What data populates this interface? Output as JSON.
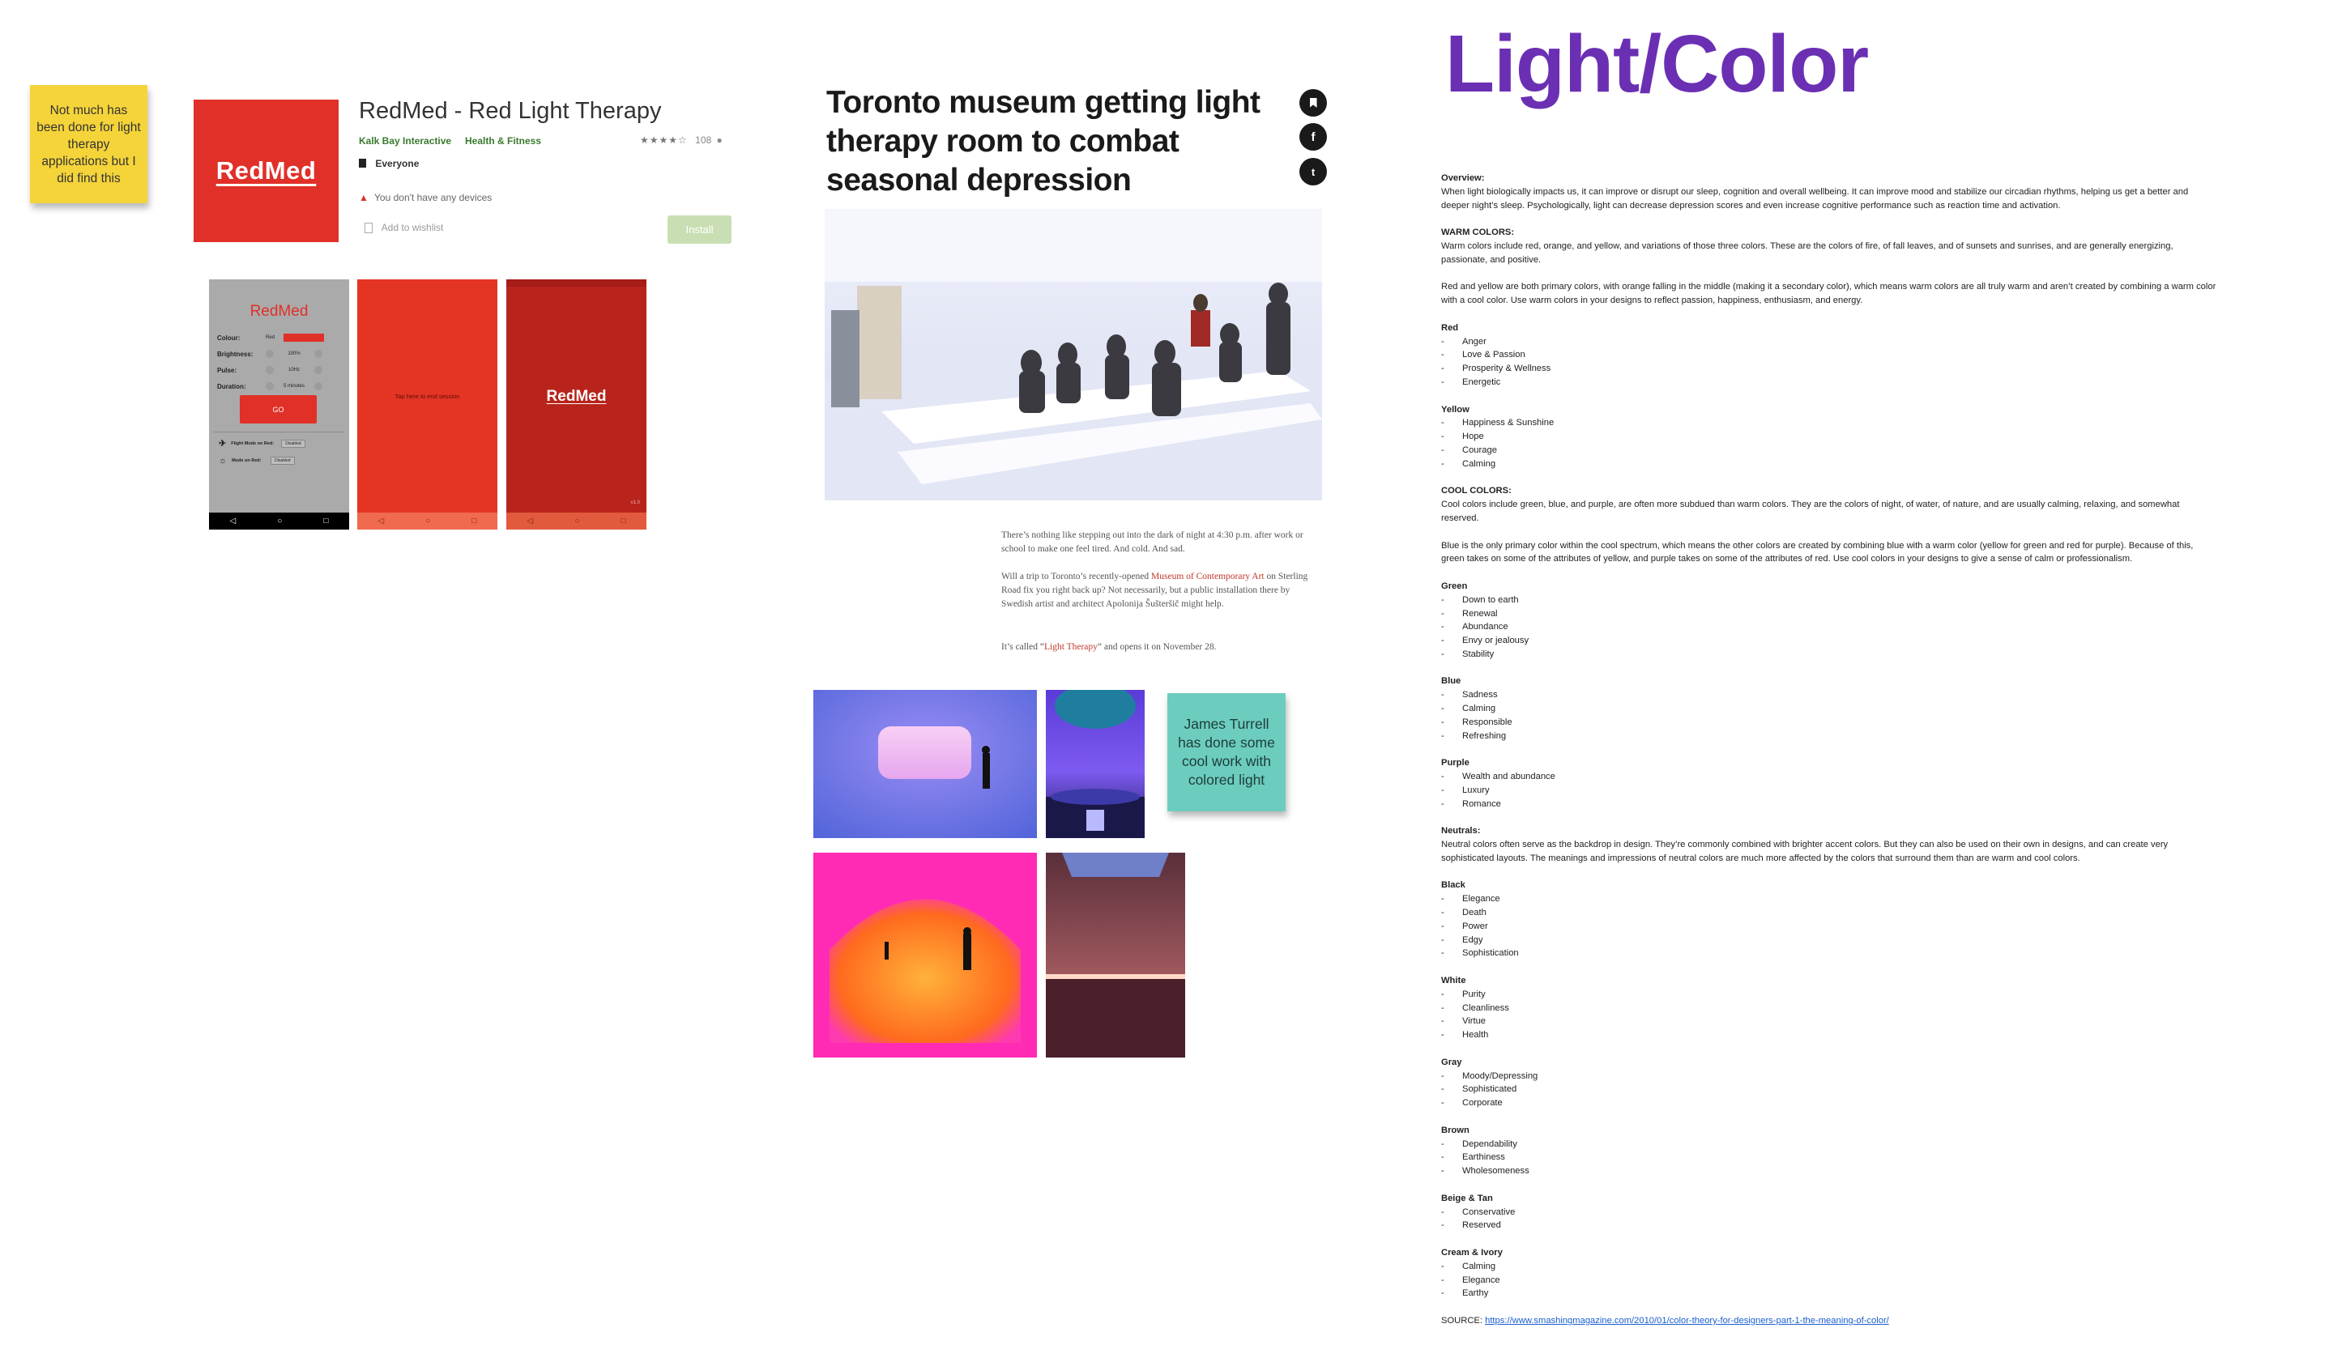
{
  "sticky_notes": {
    "yellow": "Not much has been done for light therapy applications but I did find this",
    "teal": "James Turrell has done some cool work with colored light"
  },
  "app_listing": {
    "logo_text": "RedMed",
    "title": "RedMed - Red Light Therapy",
    "developer": "Kalk Bay Interactive",
    "category": "Health & Fitness",
    "rating_count": "108",
    "content_rating": "Everyone",
    "devices_warning": "You don't have any devices",
    "wishlist": "Add to wishlist",
    "install": "Install",
    "screenshots": {
      "settings": {
        "title": "RedMed",
        "rows": [
          {
            "label": "Colour:",
            "value": "Red"
          },
          {
            "label": "Brightness:",
            "value": "100%"
          },
          {
            "label": "Pulse:",
            "value": "10Hz"
          },
          {
            "label": "Duration:",
            "value": "5 minutes"
          }
        ],
        "go": "GO",
        "flight_mode": "Flight Mode on Red:",
        "mode_on_red": "Mode on Red:",
        "toggle": "Disabled"
      },
      "session": {
        "text": "Tap here to end session"
      },
      "splash": {
        "logo_text": "RedMed",
        "version": "v1.0"
      }
    }
  },
  "article": {
    "headline": "Toronto museum getting light therapy room to combat seasonal depression",
    "social_icons": [
      "bookmark-icon",
      "facebook-icon",
      "twitter-icon"
    ],
    "p1": "There’s nothing like stepping out into the dark of night at 4:30 p.m. after work or school to make one feel tired. And cold. And sad.",
    "p2_a": "Will a trip to Toronto’s recently-opened ",
    "p2_link": "Museum of Contemporary Art",
    "p2_b": " on Sterling Road fix you right back up? Not necessarily, but a public installation there by Swedish artist and architect Apolonija Šušteršič might help.",
    "p3_a": "It’s called “",
    "p3_link": "Light Therapy",
    "p3_b": "” and opens it on November 28."
  },
  "doc": {
    "title": "Light/Color",
    "overview_heading": "Overview:",
    "overview": "When light biologically impacts us, it can improve or disrupt our sleep, cognition and overall wellbeing. It can improve mood and stabilize our circadian rhythms, helping us get a better and deeper night’s sleep. Psychologically, light can decrease depression scores and even increase cognitive performance such as reaction time and activation.",
    "warm_heading": "WARM COLORS:",
    "warm_p1": "Warm colors include red, orange, and yellow, and variations of those three colors. These are the colors of fire, of fall leaves, and of sunsets and sunrises, and are generally energizing, passionate, and positive.",
    "warm_p2": "Red and yellow are both primary colors, with orange falling in the middle (making it a secondary color), which means warm colors are all truly warm and aren’t created by combining a warm color with a cool color. Use warm colors in your designs to reflect passion, happiness, enthusiasm, and energy.",
    "red": {
      "heading": "Red",
      "items": [
        "Anger",
        "Love & Passion",
        "Prosperity & Wellness",
        "Energetic"
      ]
    },
    "yellow": {
      "heading": "Yellow",
      "items": [
        "Happiness & Sunshine",
        "Hope",
        "Courage",
        "Calming"
      ]
    },
    "cool_heading": "COOL COLORS:",
    "cool_p1": "Cool colors include green, blue, and purple, are often more subdued than warm colors. They are the colors of night, of water, of nature, and are usually calming, relaxing, and somewhat reserved.",
    "cool_p2": "Blue is the only primary color within the cool spectrum, which means the other colors are created by combining blue with a warm color (yellow for green and red for purple). Because of this, green takes on some of the attributes of yellow, and purple takes on some of the attributes of red. Use cool colors in your designs to give a sense of calm or professionalism.",
    "green": {
      "heading": "Green",
      "items": [
        "Down to earth",
        "Renewal",
        "Abundance",
        "Envy or jealousy",
        "Stability"
      ]
    },
    "blue": {
      "heading": "Blue",
      "items": [
        "Sadness",
        "Calming",
        "Responsible",
        "Refreshing"
      ]
    },
    "purple": {
      "heading": "Purple",
      "items": [
        "Wealth and abundance",
        "Luxury",
        "Romance"
      ]
    },
    "neutral_heading": "Neutrals:",
    "neutral_p": "Neutral colors often serve as the backdrop in design. They’re commonly combined with brighter accent colors. But they can also be used on their own in designs, and can create very sophisticated layouts. The meanings and impressions of neutral colors are much more affected by the colors that surround them than are warm and cool colors.",
    "black": {
      "heading": "Black",
      "items": [
        "Elegance",
        "Death",
        "Power",
        "Edgy",
        "Sophistication"
      ]
    },
    "white": {
      "heading": "White",
      "items": [
        "Purity",
        "Cleanliness",
        "Virtue",
        "Health"
      ]
    },
    "gray": {
      "heading": "Gray",
      "items": [
        "Moody/Depressing",
        "Sophisticated",
        "Corporate"
      ]
    },
    "brown": {
      "heading": "Brown",
      "items": [
        "Dependability",
        "Earthiness",
        "Wholesomeness"
      ]
    },
    "beige": {
      "heading": "Beige & Tan",
      "items": [
        "Conservative",
        "Reserved"
      ]
    },
    "cream": {
      "heading": "Cream & Ivory",
      "items": [
        "Calming",
        "Elegance",
        "Earthy"
      ]
    },
    "source_label": "SOURCE: ",
    "source_url": "https://www.smashingmagazine.com/2010/01/color-theory-for-designers-part-1-the-meaning-of-color/"
  },
  "colors": {
    "accent_purple": "#6b2fb3",
    "redmed_red": "#e03028",
    "sticky_yellow": "#f5d43a",
    "sticky_teal": "#6ccdbf",
    "store_green": "#3a7a2e"
  }
}
